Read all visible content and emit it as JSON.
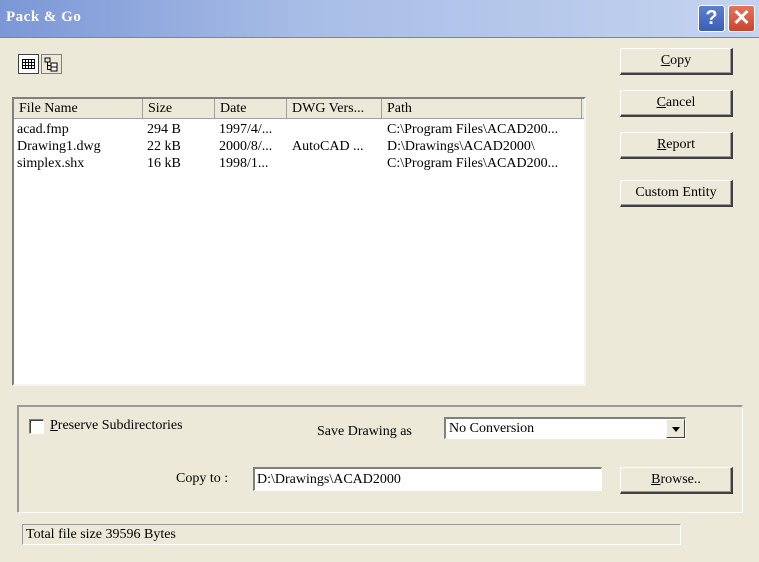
{
  "window": {
    "title": "Pack & Go",
    "help_glyph": "?",
    "close_glyph": "✕"
  },
  "toolbar": {
    "details_icon": "details-view-icon",
    "tree_icon": "tree-view-icon"
  },
  "file_list": {
    "columns": [
      "File Name",
      "Size",
      "Date",
      "DWG Vers...",
      "Path"
    ],
    "rows": [
      [
        "acad.fmp",
        "294 B",
        "1997/4/...",
        "",
        "C:\\Program Files\\ACAD200..."
      ],
      [
        "Drawing1.dwg",
        "22 kB",
        "2000/8/...",
        "AutoCAD ...",
        "D:\\Drawings\\ACAD2000\\"
      ],
      [
        "simplex.shx",
        "16 kB",
        "1998/1...",
        "",
        "C:\\Program Files\\ACAD200..."
      ]
    ]
  },
  "buttons": {
    "copy": {
      "first": "C",
      "rest": "opy"
    },
    "cancel": {
      "first": "C",
      "rest": "ancel"
    },
    "report": {
      "first": "R",
      "rest": "eport"
    },
    "custom_entity": "Custom Entity",
    "browse": {
      "first": "B",
      "rest": "rowse.."
    }
  },
  "options": {
    "preserve_subdirectories": {
      "first": "P",
      "rest": "reserve Subdirectories",
      "checked": false
    },
    "save_drawing_as_label": "Save Drawing as",
    "save_drawing_as_value": "No Conversion",
    "copy_to_label": "Copy to :",
    "copy_to_value": "D:\\Drawings\\ACAD2000"
  },
  "status": {
    "text": "Total file size 39596 Bytes"
  }
}
